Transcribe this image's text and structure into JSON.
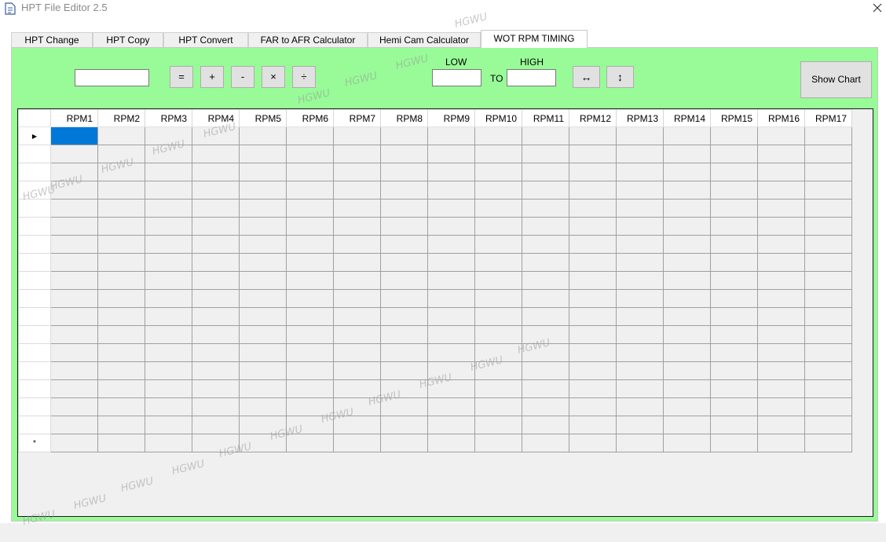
{
  "window": {
    "title": "HPT File Editor 2.5",
    "close_glyph": "✕"
  },
  "tabs": [
    {
      "label": "HPT Change"
    },
    {
      "label": "HPT Copy"
    },
    {
      "label": "HPT Convert"
    },
    {
      "label": "FAR to AFR Calculator"
    },
    {
      "label": "Hemi Cam Calculator"
    },
    {
      "label": "WOT RPM TIMING",
      "active": true
    }
  ],
  "toolbar": {
    "value_input": "",
    "operators": [
      "=",
      "+",
      "-",
      "×",
      "÷"
    ],
    "low_label": "LOW",
    "high_label": "HIGH",
    "to_label": "TO",
    "low_value": "",
    "high_value": "",
    "horizontal_fill_glyph": "↔",
    "vertical_fill_glyph": "↕",
    "show_chart_label": "Show Chart"
  },
  "grid": {
    "columns": [
      "RPM1",
      "RPM2",
      "RPM3",
      "RPM4",
      "RPM5",
      "RPM6",
      "RPM7",
      "RPM8",
      "RPM9",
      "RPM10",
      "RPM11",
      "RPM12",
      "RPM13",
      "RPM14",
      "RPM15",
      "RPM16",
      "RPM17"
    ],
    "row_count": 18,
    "current_row_glyph": "▶",
    "new_row_glyph": "*"
  },
  "watermark_text": "HGWU"
}
